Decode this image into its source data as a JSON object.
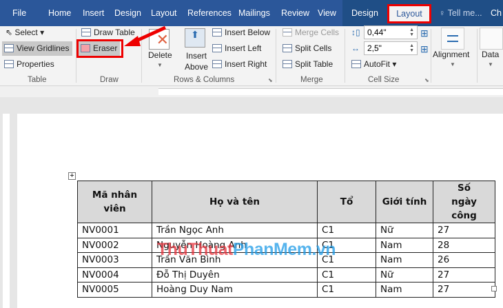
{
  "tabs": [
    "File",
    "Home",
    "Insert",
    "Design",
    "Layout",
    "References",
    "Mailings",
    "Review",
    "View",
    "Design",
    "Layout",
    "Tell me...",
    "Ch"
  ],
  "ribbon": {
    "table": {
      "select": "Select",
      "view_gridlines": "View Gridlines",
      "properties": "Properties",
      "label": "Table"
    },
    "draw": {
      "draw_table": "Draw Table",
      "eraser": "Eraser",
      "label": "Draw"
    },
    "rows_columns": {
      "delete": "Delete",
      "insert_above_1": "Insert",
      "insert_above_2": "Above",
      "insert_below": "Insert Below",
      "insert_left": "Insert Left",
      "insert_right": "Insert Right",
      "label": "Rows & Columns"
    },
    "merge": {
      "merge_cells": "Merge Cells",
      "split_cells": "Split Cells",
      "split_table": "Split Table",
      "label": "Merge"
    },
    "cell_size": {
      "height": "0,44\"",
      "width": "2,5\"",
      "autofit": "AutoFit",
      "label": "Cell Size"
    },
    "alignment": "Alignment",
    "data": "Data"
  },
  "table": {
    "headers": [
      [
        "Mã nhân",
        "viên"
      ],
      [
        "Họ và tên"
      ],
      [
        "Tổ"
      ],
      [
        "Giới tính"
      ],
      [
        "Số",
        "ngày công"
      ]
    ],
    "rows": [
      [
        "NV0001",
        "Trần Ngọc Anh",
        "C1",
        "Nữ",
        "27"
      ],
      [
        "NV0002",
        "Nguyễn Hoàng Anh",
        "C1",
        "Nam",
        "28"
      ],
      [
        "NV0003",
        "Trần Văn Bình",
        "C1",
        "Nam",
        "26"
      ],
      [
        "NV0004",
        "Đỗ Thị Duyên",
        "C1",
        "Nữ",
        "27"
      ],
      [
        "NV0005",
        "Hoàng Duy Nam",
        "C1",
        "Nam",
        "27"
      ]
    ]
  },
  "watermark": {
    "a": "ThuThuat",
    "b": "PhanMem.vn"
  },
  "colors": {
    "accent": "#2b579a",
    "highlight": "#ee0000"
  }
}
